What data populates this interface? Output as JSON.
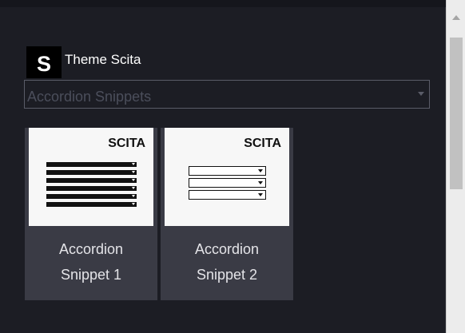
{
  "theme": {
    "logo_letter": "S",
    "name": "Theme Scita"
  },
  "category_select": {
    "selected": "Accordion Snippets"
  },
  "snippets": [
    {
      "brand": "SCITA",
      "label_line1": "Accordion",
      "label_line2": "Snippet 1"
    },
    {
      "brand": "SCITA",
      "label_line1": "Accordion",
      "label_line2": "Snippet 2"
    }
  ],
  "colors": {
    "panel_bg": "#1c1d24",
    "card_bg": "#3a3b45",
    "thumb_bg": "#f7f7f7",
    "select_text": "#4b4e5b",
    "scrollbar_bg": "#ececec"
  }
}
